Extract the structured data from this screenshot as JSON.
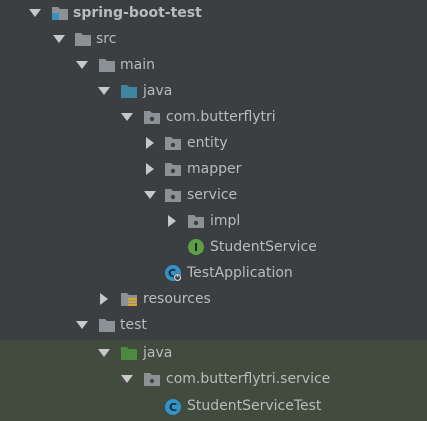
{
  "tree": {
    "project_name": "spring-boot-test",
    "nodes": [
      {
        "label": "src",
        "icon": "folder-icon",
        "expanded": true
      },
      {
        "label": "main",
        "icon": "folder-icon",
        "expanded": true
      },
      {
        "label": "java",
        "icon": "source-folder-icon",
        "expanded": true
      },
      {
        "label": "com.butterflytri",
        "icon": "package-icon",
        "expanded": true
      },
      {
        "label": "entity",
        "icon": "package-icon",
        "expanded": false
      },
      {
        "label": "mapper",
        "icon": "package-icon",
        "expanded": false
      },
      {
        "label": "service",
        "icon": "package-icon",
        "expanded": true
      },
      {
        "label": "impl",
        "icon": "package-icon",
        "expanded": false
      },
      {
        "label": "StudentService",
        "icon": "interface-icon"
      },
      {
        "label": "TestApplication",
        "icon": "spring-boot-class-icon"
      },
      {
        "label": "resources",
        "icon": "resources-folder-icon",
        "expanded": false
      },
      {
        "label": "test",
        "icon": "folder-icon",
        "expanded": true
      },
      {
        "label": "java",
        "icon": "test-source-folder-icon",
        "expanded": true
      },
      {
        "label": "com.butterflytri.service",
        "icon": "package-icon",
        "expanded": true
      },
      {
        "label": "StudentServiceTest",
        "icon": "class-icon"
      }
    ]
  },
  "colors": {
    "background": "#3c3f41",
    "text": "#bbbbbb",
    "test_highlight": "#414b3e",
    "folder": "#8c9196",
    "source_folder": "#3e86a0",
    "test_folder": "#4e8a3e",
    "interface": "#5e9e48",
    "class": "#3592c4"
  }
}
